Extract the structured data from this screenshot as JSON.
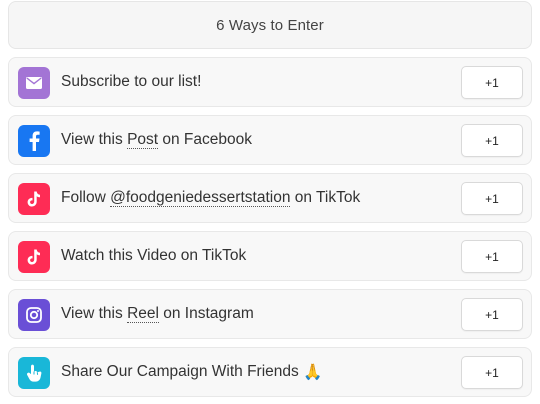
{
  "header": {
    "title": "6 Ways to Enter"
  },
  "entries": [
    {
      "icon": "mail-icon",
      "icon_color": "#a374d5",
      "text_before": "Subscribe to our list!",
      "link": "",
      "text_after": "",
      "points": "+1"
    },
    {
      "icon": "facebook-icon",
      "icon_color": "#1877f2",
      "text_before": "View this ",
      "link": "Post",
      "text_after": " on Facebook",
      "points": "+1"
    },
    {
      "icon": "tiktok-icon",
      "icon_color": "#fe2c55",
      "text_before": "Follow ",
      "link": "@foodgeniedessertstation",
      "text_after": " on TikTok",
      "points": "+1"
    },
    {
      "icon": "tiktok-icon",
      "icon_color": "#fe2c55",
      "text_before": "Watch this Video on TikTok",
      "link": "",
      "text_after": "",
      "points": "+1"
    },
    {
      "icon": "instagram-icon",
      "icon_color": "#6a4fd6",
      "text_before": "View this ",
      "link": "Reel",
      "text_after": " on Instagram",
      "points": "+1"
    },
    {
      "icon": "share-hand-icon",
      "icon_color": "#19b7d8",
      "text_before": "Share Our Campaign With Friends ",
      "link": "",
      "text_after": "",
      "emoji": "🙏",
      "points": "+1"
    }
  ]
}
